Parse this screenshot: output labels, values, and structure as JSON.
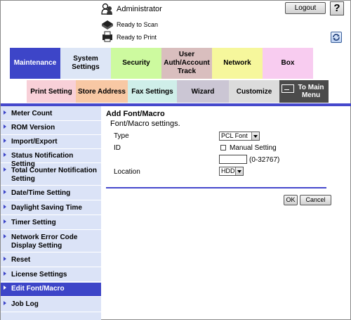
{
  "header": {
    "user_label": "Administrator",
    "logout_label": "Logout",
    "help_label": "?",
    "status_scan": "Ready to Scan",
    "status_print": "Ready to Print"
  },
  "tabs": [
    {
      "label": "Maintenance"
    },
    {
      "label": "System Settings"
    },
    {
      "label": "Security"
    },
    {
      "label": "User Auth/Account Track"
    },
    {
      "label": "Network"
    },
    {
      "label": "Box"
    }
  ],
  "subtabs": [
    {
      "label": "Print Setting"
    },
    {
      "label": "Store Address"
    },
    {
      "label": "Fax Settings"
    },
    {
      "label": "Wizard"
    },
    {
      "label": "Customize"
    },
    {
      "label": "To Main Menu"
    }
  ],
  "sidebar": {
    "items": [
      {
        "label": "Meter Count"
      },
      {
        "label": "ROM Version"
      },
      {
        "label": "Import/Export"
      },
      {
        "label": "Status Notification Setting"
      },
      {
        "label": "Total Counter Notification Setting"
      },
      {
        "label": "Date/Time Setting"
      },
      {
        "label": "Daylight Saving Time"
      },
      {
        "label": "Timer Setting"
      },
      {
        "label": "Network Error Code Display Setting"
      },
      {
        "label": "Reset"
      },
      {
        "label": "License Settings"
      },
      {
        "label": "Edit Font/Macro"
      },
      {
        "label": "Job Log"
      }
    ],
    "active_item": "Edit Font/Macro"
  },
  "content": {
    "title": "Add Font/Macro",
    "subtitle": "Font/Macro settings.",
    "type_label": "Type",
    "type_value": "PCL Font",
    "id_label": "ID",
    "manual_setting_label": "Manual Setting",
    "manual_setting_checked": false,
    "id_value": "",
    "id_range": "(0-32767)",
    "location_label": "Location",
    "location_value": "HDD",
    "ok_label": "OK",
    "cancel_label": "Cancel"
  },
  "colors": {
    "accent": "#3d45c8",
    "sidebar_bg": "#dbe3f7"
  }
}
